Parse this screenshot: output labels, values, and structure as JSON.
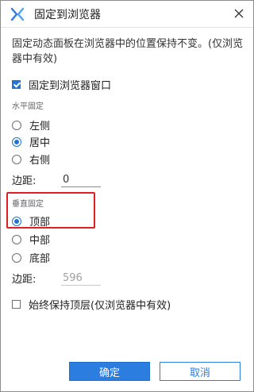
{
  "window": {
    "title": "固定到浏览器"
  },
  "description": "固定动态面板在浏览器中的位置保持不变。(仅浏览器中有效)",
  "pin_to_browser": {
    "label": "固定到浏览器窗口",
    "checked": true
  },
  "horizontal": {
    "section_label": "水平固定",
    "options": [
      {
        "label": "左侧",
        "checked": false
      },
      {
        "label": "居中",
        "checked": true
      },
      {
        "label": "右侧",
        "checked": false
      }
    ],
    "margin_label": "边距:",
    "margin_value": "0"
  },
  "vertical": {
    "section_label": "垂直固定",
    "options": [
      {
        "label": "顶部",
        "checked": true
      },
      {
        "label": "中部",
        "checked": false
      },
      {
        "label": "底部",
        "checked": false
      }
    ],
    "margin_label": "边距:",
    "margin_value": "596"
  },
  "always_on_top": {
    "label": "始终保持顶层(仅浏览器中有效)",
    "checked": false
  },
  "buttons": {
    "ok": "确定",
    "cancel": "取消"
  },
  "colors": {
    "accent": "#2b7de0",
    "highlight": "#e02020"
  },
  "icons": {
    "logo": "axure-logo-icon",
    "close": "close-icon"
  }
}
